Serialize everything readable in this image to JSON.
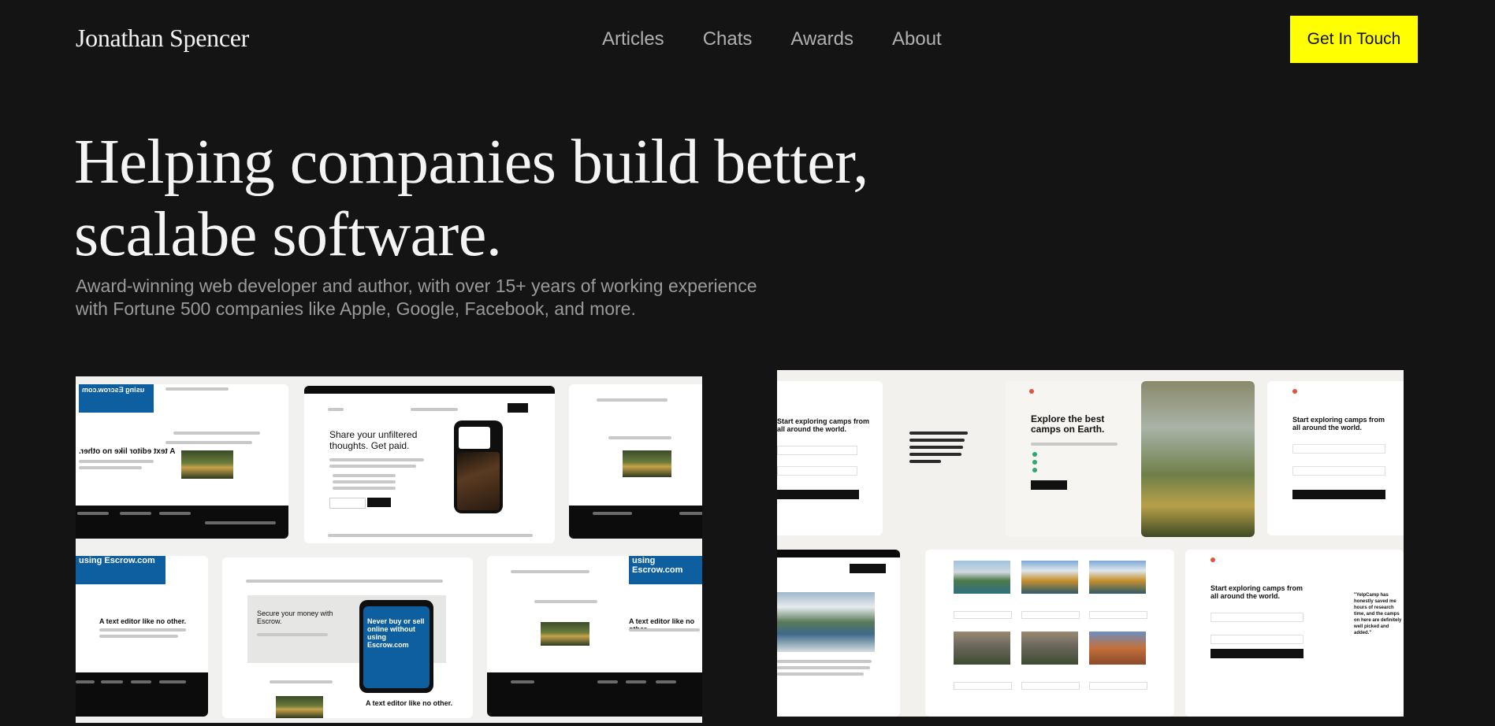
{
  "header": {
    "logo": "Jonathan Spencer",
    "nav": [
      "Articles",
      "Chats",
      "Awards",
      "About"
    ],
    "cta_label": "Get In Touch"
  },
  "hero": {
    "title_line1": "Helping companies build better,",
    "title_line2": "scalabe software.",
    "subtitle": "Award-winning web developer and author, with over 15+ years of working experience with Fortune 500 companies like Apple, Google, Facebook, and more."
  },
  "showcase_left": {
    "mock_headline": "Share your unfiltered thoughts. Get paid.",
    "mock_secure": "Secure your money with Escrow.",
    "mock_phone": "Never buy or sell online without using Escrow.com",
    "mock_editor": "A text editor like no other.",
    "mock_brand": "using Escrow.com"
  },
  "showcase_right": {
    "mock_headline": "Explore the best camps on Earth.",
    "mock_start": "Start exploring camps from all around the world.",
    "mock_quote": "\"YelpCamp has honestly saved me hours of research time, and the camps on here are definitely well picked and added.\""
  },
  "colors": {
    "background": "#141414",
    "accent": "#ffff00",
    "muted": "#9a9a9a"
  }
}
